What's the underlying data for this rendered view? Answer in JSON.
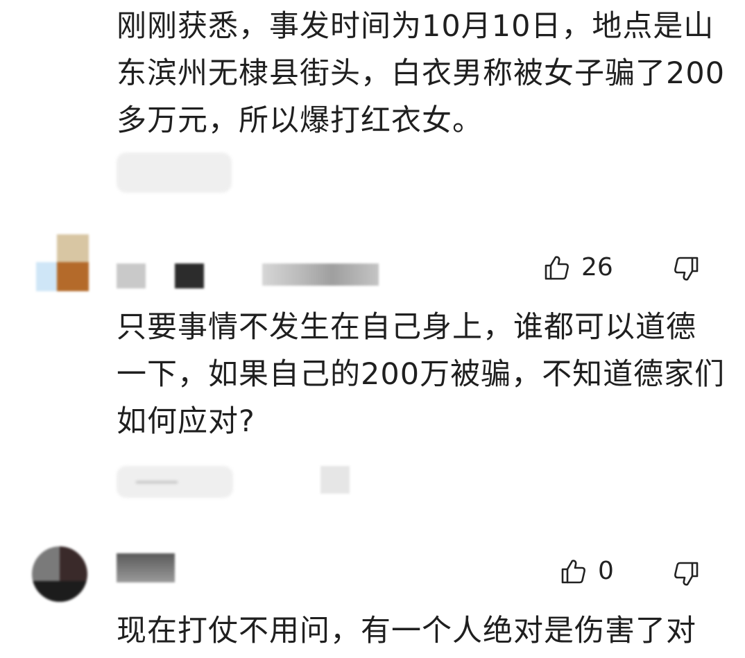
{
  "comments": [
    {
      "lines": [
        "刚刚获悉，事发时间为10月10日，地点是山",
        "东滨州无棣县街头，白衣男称被女子骗了200",
        "多万元，所以爆打红衣女。"
      ]
    },
    {
      "like_count": "26",
      "lines": [
        "只要事情不发生在自己身上，谁都可以道德",
        "一下，如果自己的200万被骗，不知道德家们",
        "如何应对?"
      ]
    },
    {
      "like_count": "0",
      "lines": [
        "现在打仗不用问，有一个人绝对是伤害了对"
      ]
    }
  ],
  "icons": {
    "like": "thumbs-up-icon",
    "dislike": "thumbs-down-icon"
  },
  "colors": {
    "text": "#1f1f1f",
    "blur_gray": "#efefef"
  }
}
